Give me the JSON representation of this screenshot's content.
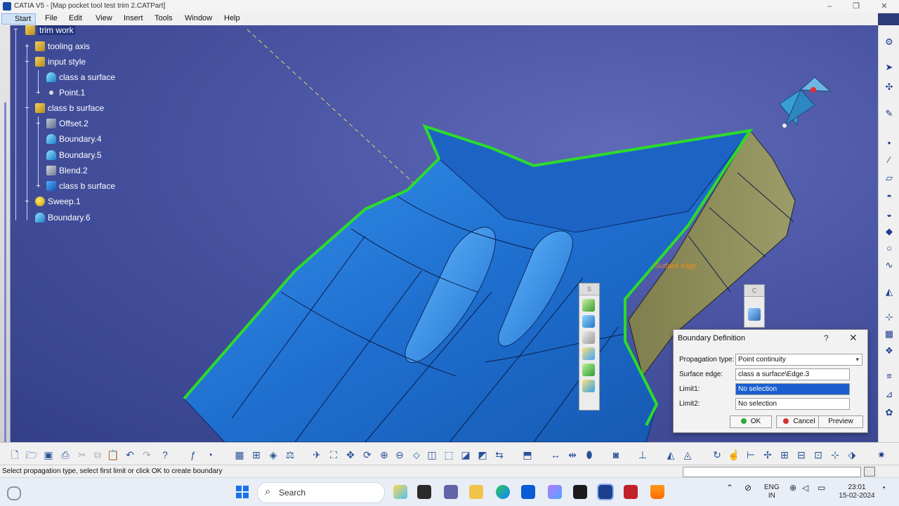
{
  "window": {
    "title": "CATIA V5 - [Map pocket  tool test trim 2.CATPart]",
    "minimize": "–",
    "restore": "❐",
    "close": "✕"
  },
  "menu": {
    "start": "Start",
    "file": "File",
    "edit": "Edit",
    "view": "View",
    "insert": "Insert",
    "tools": "Tools",
    "window": "Window",
    "help": "Help"
  },
  "tree": {
    "items": [
      {
        "label": "trim work",
        "icon": "folder-icon"
      },
      {
        "label": "tooling axis",
        "icon": "folder-icon"
      },
      {
        "label": "input style",
        "icon": "folder-icon"
      },
      {
        "label": "class a surface",
        "icon": "surface-icon"
      },
      {
        "label": "Point.1",
        "icon": "point-icon"
      },
      {
        "label": "class b surface",
        "icon": "folder-icon"
      },
      {
        "label": "Offset.2",
        "icon": "offset-icon"
      },
      {
        "label": "Boundary.4",
        "icon": "boundary-icon"
      },
      {
        "label": "Boundary.5",
        "icon": "boundary-icon"
      },
      {
        "label": "Blend.2",
        "icon": "blend-icon"
      },
      {
        "label": "class b surface",
        "icon": "surface-icon"
      },
      {
        "label": "Sweep.1",
        "icon": "sweep-icon"
      },
      {
        "label": "Boundary.6",
        "icon": "boundary-icon"
      }
    ]
  },
  "viewport": {
    "annotation": "Surface edge",
    "compass": "compass-icon",
    "colors": {
      "background": "#3f4a98",
      "surface": "#2e7fd8",
      "edge_highlight": "#2bdc2b",
      "side_wall": "#8f8f5a"
    }
  },
  "palettes": {
    "palette1_header": "S",
    "palette2_header": "C"
  },
  "dialog": {
    "title": "Boundary Definition",
    "help": "?",
    "close": "✕",
    "propagation_label": "Propagation type:",
    "propagation_value": "Point continuity",
    "surface_edge_label": "Surface edge:",
    "surface_edge_value": "class a surface\\Edge.3",
    "limit1_label": "Limit1:",
    "limit1_value": "No selection",
    "limit2_label": "Limit2:",
    "limit2_value": "No selection",
    "ok": "OK",
    "cancel": "Cancel",
    "preview": "Preview"
  },
  "status": {
    "message": "Select propagation type, select first limit or click OK to create boundary"
  },
  "taskbar": {
    "search": "Search",
    "lang_line1": "ENG",
    "lang_line2": "IN",
    "time": "23:01",
    "date": "15-02-2024"
  }
}
